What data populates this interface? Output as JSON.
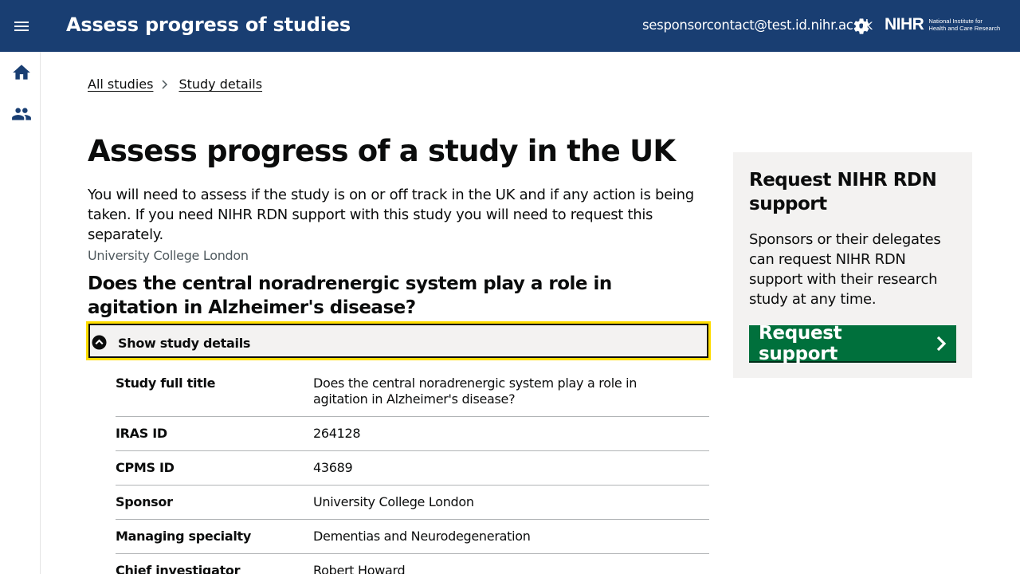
{
  "header": {
    "title": "Assess progress of studies",
    "user_email": "sesponsorcontact@test.id.nihr.ac.uk",
    "logo": {
      "mark": "NIHR",
      "line1": "National Institute for",
      "line2": "Health and Care Research"
    },
    "colors": {
      "background": "#193e72",
      "text": "#ffffff"
    },
    "icons": {
      "menu": "menu-icon",
      "settings": "gear-icon"
    }
  },
  "sidenav": {
    "items": [
      {
        "icon": "home-icon",
        "label": "Home"
      },
      {
        "icon": "people-icon",
        "label": "Users"
      }
    ]
  },
  "breadcrumb": {
    "items": [
      {
        "label": "All studies"
      },
      {
        "label": "Study details"
      }
    ]
  },
  "main": {
    "title": "Assess progress of a study in the UK",
    "intro": "You will need to assess if the study is on or off track in the UK and if any action is being taken. If you need NIHR RDN support with this study you will need to request this separately.",
    "organisation": "University College London",
    "study_title": "Does the central noradrenergic system play a role in agitation in Alzheimer's disease?",
    "details": {
      "toggle_label": "Show study details",
      "expanded": true,
      "rows": [
        {
          "key": "Study full title",
          "value": "Does the central noradrenergic system play a role in agitation in Alzheimer's disease?"
        },
        {
          "key": "IRAS ID",
          "value": "264128"
        },
        {
          "key": "CPMS ID",
          "value": "43689"
        },
        {
          "key": "Sponsor",
          "value": "University College London"
        },
        {
          "key": "Managing specialty",
          "value": "Dementias and Neurodegeneration"
        },
        {
          "key": "Chief investigator",
          "value": "Robert Howard"
        }
      ]
    }
  },
  "aside": {
    "title": "Request NIHR RDN support",
    "body": "Sponsors or their delegates can request NIHR RDN support with their research study at any time.",
    "button_label": "Request support",
    "colors": {
      "panel": "#f3f2f1",
      "button": "#00703c"
    }
  },
  "colors": {
    "focus": "#ffdd00",
    "text": "#0b0c0c",
    "secondary_text": "#505a5f"
  }
}
